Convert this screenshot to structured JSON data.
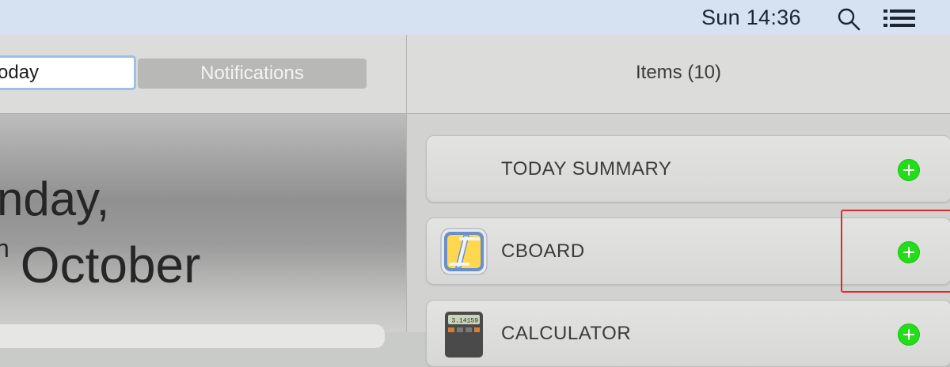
{
  "menubar": {
    "clock": "Sun 14:36",
    "icons": [
      "search-icon",
      "list-menu-icon"
    ],
    "background": "#d6e1f1"
  },
  "left_panel": {
    "tabs": {
      "today_label": "oday",
      "notifications_label": "Notifications"
    },
    "date": {
      "line1": "nday,",
      "day_suffix": "h",
      "month": "October"
    }
  },
  "right_panel": {
    "title": "Items (10)",
    "items": [
      {
        "label": "TODAY SUMMARY",
        "icon": "",
        "action": "add"
      },
      {
        "label": "CBOARD",
        "icon": "cboard-app-icon",
        "action": "add"
      },
      {
        "label": "CALCULATOR",
        "icon": "calculator-app-icon",
        "action": "add",
        "icon_display": "3.14159"
      }
    ]
  },
  "colors": {
    "add_button": "#23dd18",
    "selected_tab_border": "#9dbfe5",
    "highlight": "#e02a2a"
  }
}
